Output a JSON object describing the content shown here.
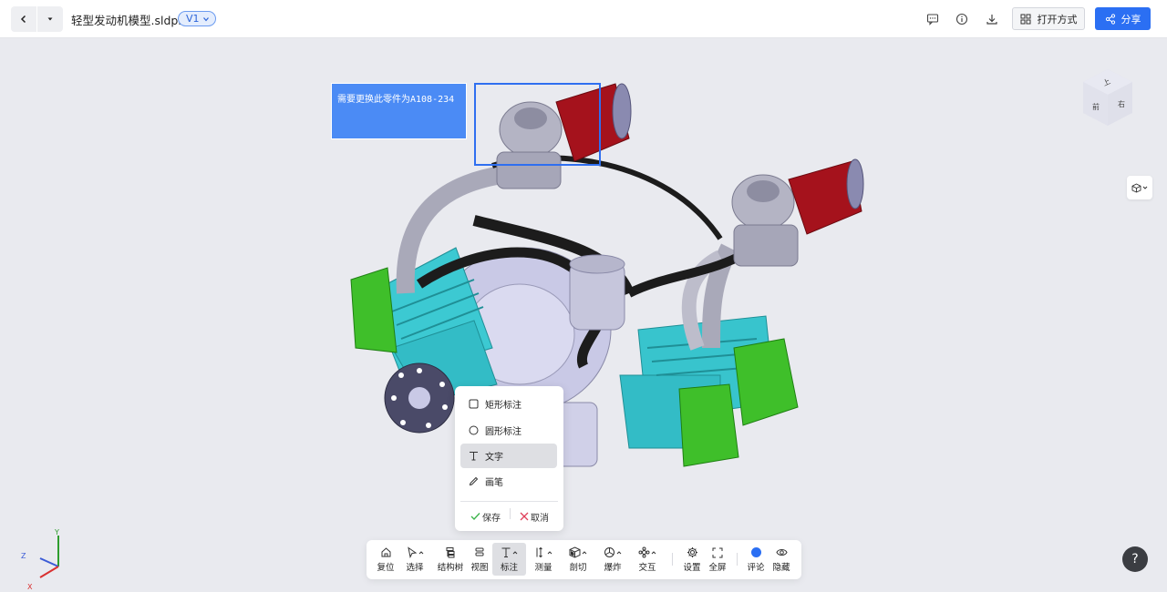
{
  "header": {
    "file_name": "轻型发动机模型.sldprt",
    "version": "V1",
    "open_with_label": "打开方式",
    "share_label": "分享"
  },
  "viewport": {
    "annotation_text": "需要更换此零件为A108-234",
    "view_cube": {
      "top": "上",
      "left": "前",
      "right": "右"
    },
    "axes": {
      "x": "X",
      "y": "Y",
      "z": "Z"
    }
  },
  "annotation_menu": {
    "items": [
      {
        "label": "矩形标注",
        "icon": "rectangle-icon"
      },
      {
        "label": "圆形标注",
        "icon": "circle-icon"
      },
      {
        "label": "文字",
        "icon": "text-icon",
        "selected": true
      },
      {
        "label": "画笔",
        "icon": "pen-icon"
      }
    ],
    "save_label": "保存",
    "cancel_label": "取消"
  },
  "toolbar": {
    "items": [
      {
        "label": "复位",
        "icon": "home-icon"
      },
      {
        "label": "选择",
        "icon": "cursor-icon"
      },
      {
        "label": "结构树",
        "icon": "tree-icon"
      },
      {
        "label": "视图",
        "icon": "layers-icon"
      },
      {
        "label": "标注",
        "icon": "text-icon",
        "active": true
      },
      {
        "label": "测量",
        "icon": "measure-icon"
      },
      {
        "label": "剖切",
        "icon": "cube-section-icon"
      },
      {
        "label": "爆炸",
        "icon": "explode-icon"
      },
      {
        "label": "交互",
        "icon": "interact-icon"
      },
      {
        "label": "设置",
        "icon": "gear-icon"
      },
      {
        "label": "全屏",
        "icon": "fullscreen-icon"
      },
      {
        "label": "评论",
        "icon": "comment-dot-icon"
      },
      {
        "label": "隐藏",
        "icon": "eye-icon"
      }
    ]
  },
  "help_label": "?",
  "colors": {
    "accent": "#2b6ff3",
    "note_bg": "#4b8bf5",
    "engine_cyan": "#35c7cf",
    "engine_green": "#3fbf2a",
    "filter_red": "#a5121c"
  }
}
